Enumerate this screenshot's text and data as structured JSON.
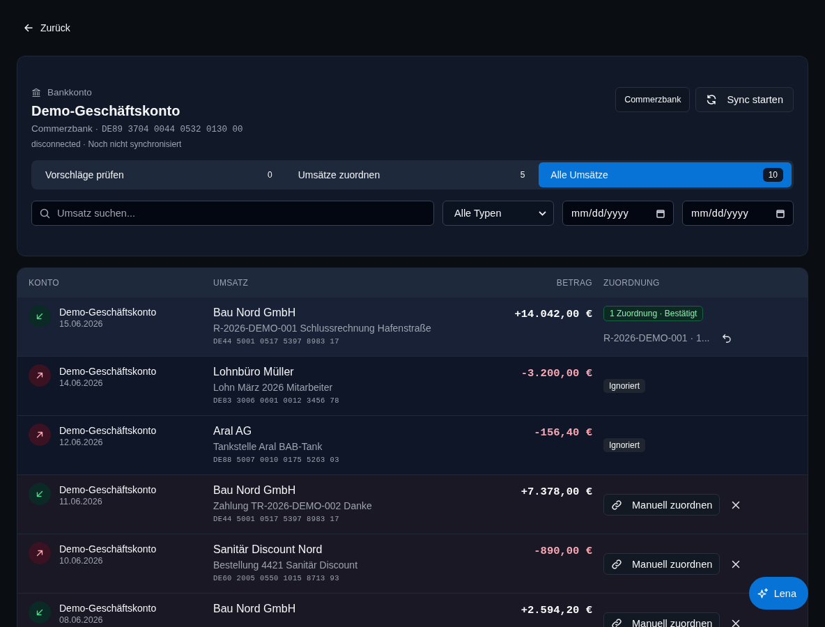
{
  "back": {
    "label": "Zurück"
  },
  "account": {
    "type_label": "Bankkonto",
    "name": "Demo-Geschäftskonto",
    "bank": "Commerzbank ·",
    "iban": "DE89 3704 0044 0532 0130 00",
    "status": "disconnected · Noch nicht synchronisiert"
  },
  "actions": [
    {
      "label": "Commerzbank",
      "kind": "plain"
    },
    {
      "label": "Sync starten",
      "kind": "sync"
    }
  ],
  "tabs": [
    {
      "label": "Vorschläge prüfen",
      "count": "0",
      "selected": false
    },
    {
      "label": "Umsätze zuordnen",
      "count": "5",
      "selected": false
    },
    {
      "label": "Alle Umsätze",
      "count": "10",
      "selected": true
    }
  ],
  "filters": {
    "search": {
      "placeholder": "Umsatz suchen..."
    },
    "type_select": {
      "value": "Alle Typen"
    },
    "date_from": {
      "placeholder": "mm/dd/yyyy"
    },
    "date_to": {
      "placeholder": "mm/dd/yyyy"
    }
  },
  "table": {
    "columns": [
      "KONTO",
      "UMSATZ",
      "BETRAG",
      "ZUORDNUNG"
    ],
    "rows": [
      {
        "kind": "incoming",
        "account": "Demo-Geschäftskonto",
        "date": "15.06.2026",
        "counterparty": "Bau Nord GmbH",
        "purpose": "R-2026-DEMO-001 Schlussrechnung Hafenstraße",
        "iban": "DE44 5001 0517 5397 8983 17",
        "amount": "+14.042,00 €",
        "assignment": {
          "kind": "confirmed",
          "badge": "1 Zuordnung · Bestätigt",
          "reference": "R-2026-DEMO-001 · 1..."
        }
      },
      {
        "kind": "outgoing",
        "account": "Demo-Geschäftskonto",
        "date": "14.06.2026",
        "counterparty": "Lohnbüro Müller",
        "purpose": "Lohn März 2026 Mitarbeiter",
        "iban": "DE83 3006 0601 0012 3456 78",
        "amount": "-3.200,00 €",
        "assignment": {
          "kind": "ignored",
          "badge": "Ignoriert"
        }
      },
      {
        "kind": "outgoing",
        "account": "Demo-Geschäftskonto",
        "date": "12.06.2026",
        "counterparty": "Aral AG",
        "purpose": "Tankstelle Aral BAB-Tank",
        "iban": "DE88 5007 0010 0175 5263 03",
        "amount": "-156,40 €",
        "assignment": {
          "kind": "ignored",
          "badge": "Ignoriert"
        }
      },
      {
        "kind": "incoming",
        "account": "Demo-Geschäftskonto",
        "date": "11.06.2026",
        "counterparty": "Bau Nord GmbH",
        "purpose": "Zahlung TR-2026-DEMO-002 Danke",
        "iban": "DE44 5001 0517 5397 8983 17",
        "amount": "+7.378,00 €",
        "assignment": {
          "kind": "open",
          "action": "Manuell zuordnen"
        }
      },
      {
        "kind": "outgoing",
        "account": "Demo-Geschäftskonto",
        "date": "10.06.2026",
        "counterparty": "Sanitär Discount Nord",
        "purpose": "Bestellung 4421 Sanitär Discount",
        "iban": "DE60 2005 0550 1015 8713 93",
        "amount": "-890,00 €",
        "assignment": {
          "kind": "open",
          "action": "Manuell zuordnen"
        }
      },
      {
        "kind": "incoming",
        "account": "Demo-Geschäftskonto",
        "date": "08.06.2026",
        "counterparty": "Bau Nord GmbH",
        "amount": "+2.594,20 €",
        "assignment": {
          "kind": "open",
          "action": "Manuell zuordnen"
        }
      }
    ]
  },
  "assistant": {
    "label": "Lena"
  }
}
